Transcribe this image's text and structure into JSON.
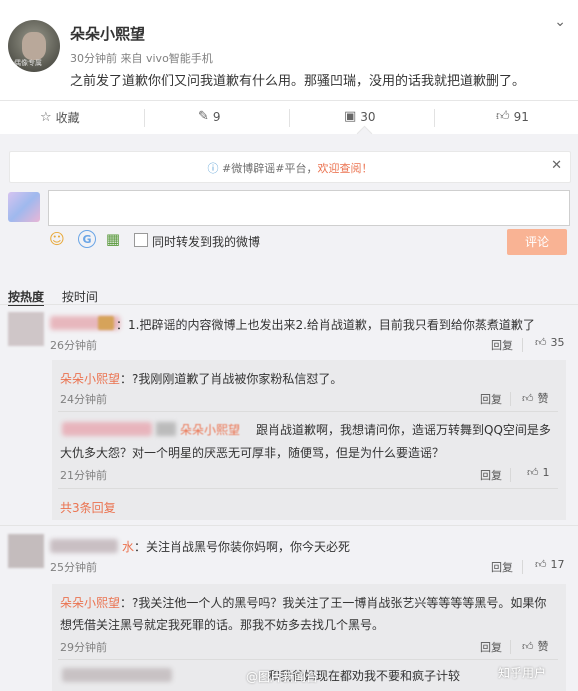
{
  "post": {
    "username": "朵朵小熙望",
    "meta": "30分钟前 来自 vivo智能手机",
    "text": "之前发了道歉你们又问我道歉有什么用。那骚凹瑞，没用的话我就把道歉删了。",
    "avatar_tag": "偶像专属"
  },
  "actions": {
    "favorite": "收藏",
    "repost_count": "9",
    "comment_count": "30",
    "like_count": "91"
  },
  "banner": {
    "prefix": "#微博辟谣#平台，",
    "highlight": "欢迎查阅！"
  },
  "composer": {
    "placeholder": "",
    "repost_label": "同时转发到我的微博",
    "submit_label": "评论"
  },
  "tabs": [
    "按热度",
    "按时间"
  ],
  "comments": [
    {
      "text": "：1.把辟谣的内容微博上也发出来2.给肖战道歉，目前我只看到给你蒸煮道歉了",
      "time": "26分钟前",
      "reply": "回复",
      "likes": "35",
      "replies": [
        {
          "author": "朵朵小熙望",
          "text": "：?我刚刚道歉了肖战被你家粉私信怼了。",
          "time": "24分钟前",
          "reply": "回复",
          "likes": "赞"
        },
        {
          "author": "朵朵小熙望",
          "text1": "跟肖战道歉啊，我想请问你，造谣万转舞到QQ空间是多",
          "text2": "大仇多大怨？对一个明星的厌恶无可厚非，随便骂，但是为什么要造谣？",
          "time": "21分钟前",
          "reply": "回复",
          "likes": "1"
        }
      ],
      "more": "共3条回复"
    },
    {
      "name_suffix": "水",
      "text": "：关注肖战黑号你装你妈啊，你今天必死",
      "time": "25分钟前",
      "reply": "回复",
      "likes": "17",
      "replies": [
        {
          "author": "朵朵小熙望",
          "text1": "：?我关注他一个人的黑号吗？我关注了王一博肖战张艺兴等等等等黑号。如果你",
          "text2": "想凭借关注黑号就定我死罪的话。那我不妨多去找几个黑号。",
          "time": "29分钟前",
          "reply": "回复",
          "likes": "赞"
        },
        {
          "text": "和我爸妈现在都劝我不要和疯子计较"
        }
      ]
    }
  ],
  "watermarks": [
    "@图片新闻台",
    "知乎用户"
  ],
  "colors": {
    "accent": "#eb7350",
    "background": "#f2f2f5",
    "submit_disabled": "#f9b394"
  }
}
